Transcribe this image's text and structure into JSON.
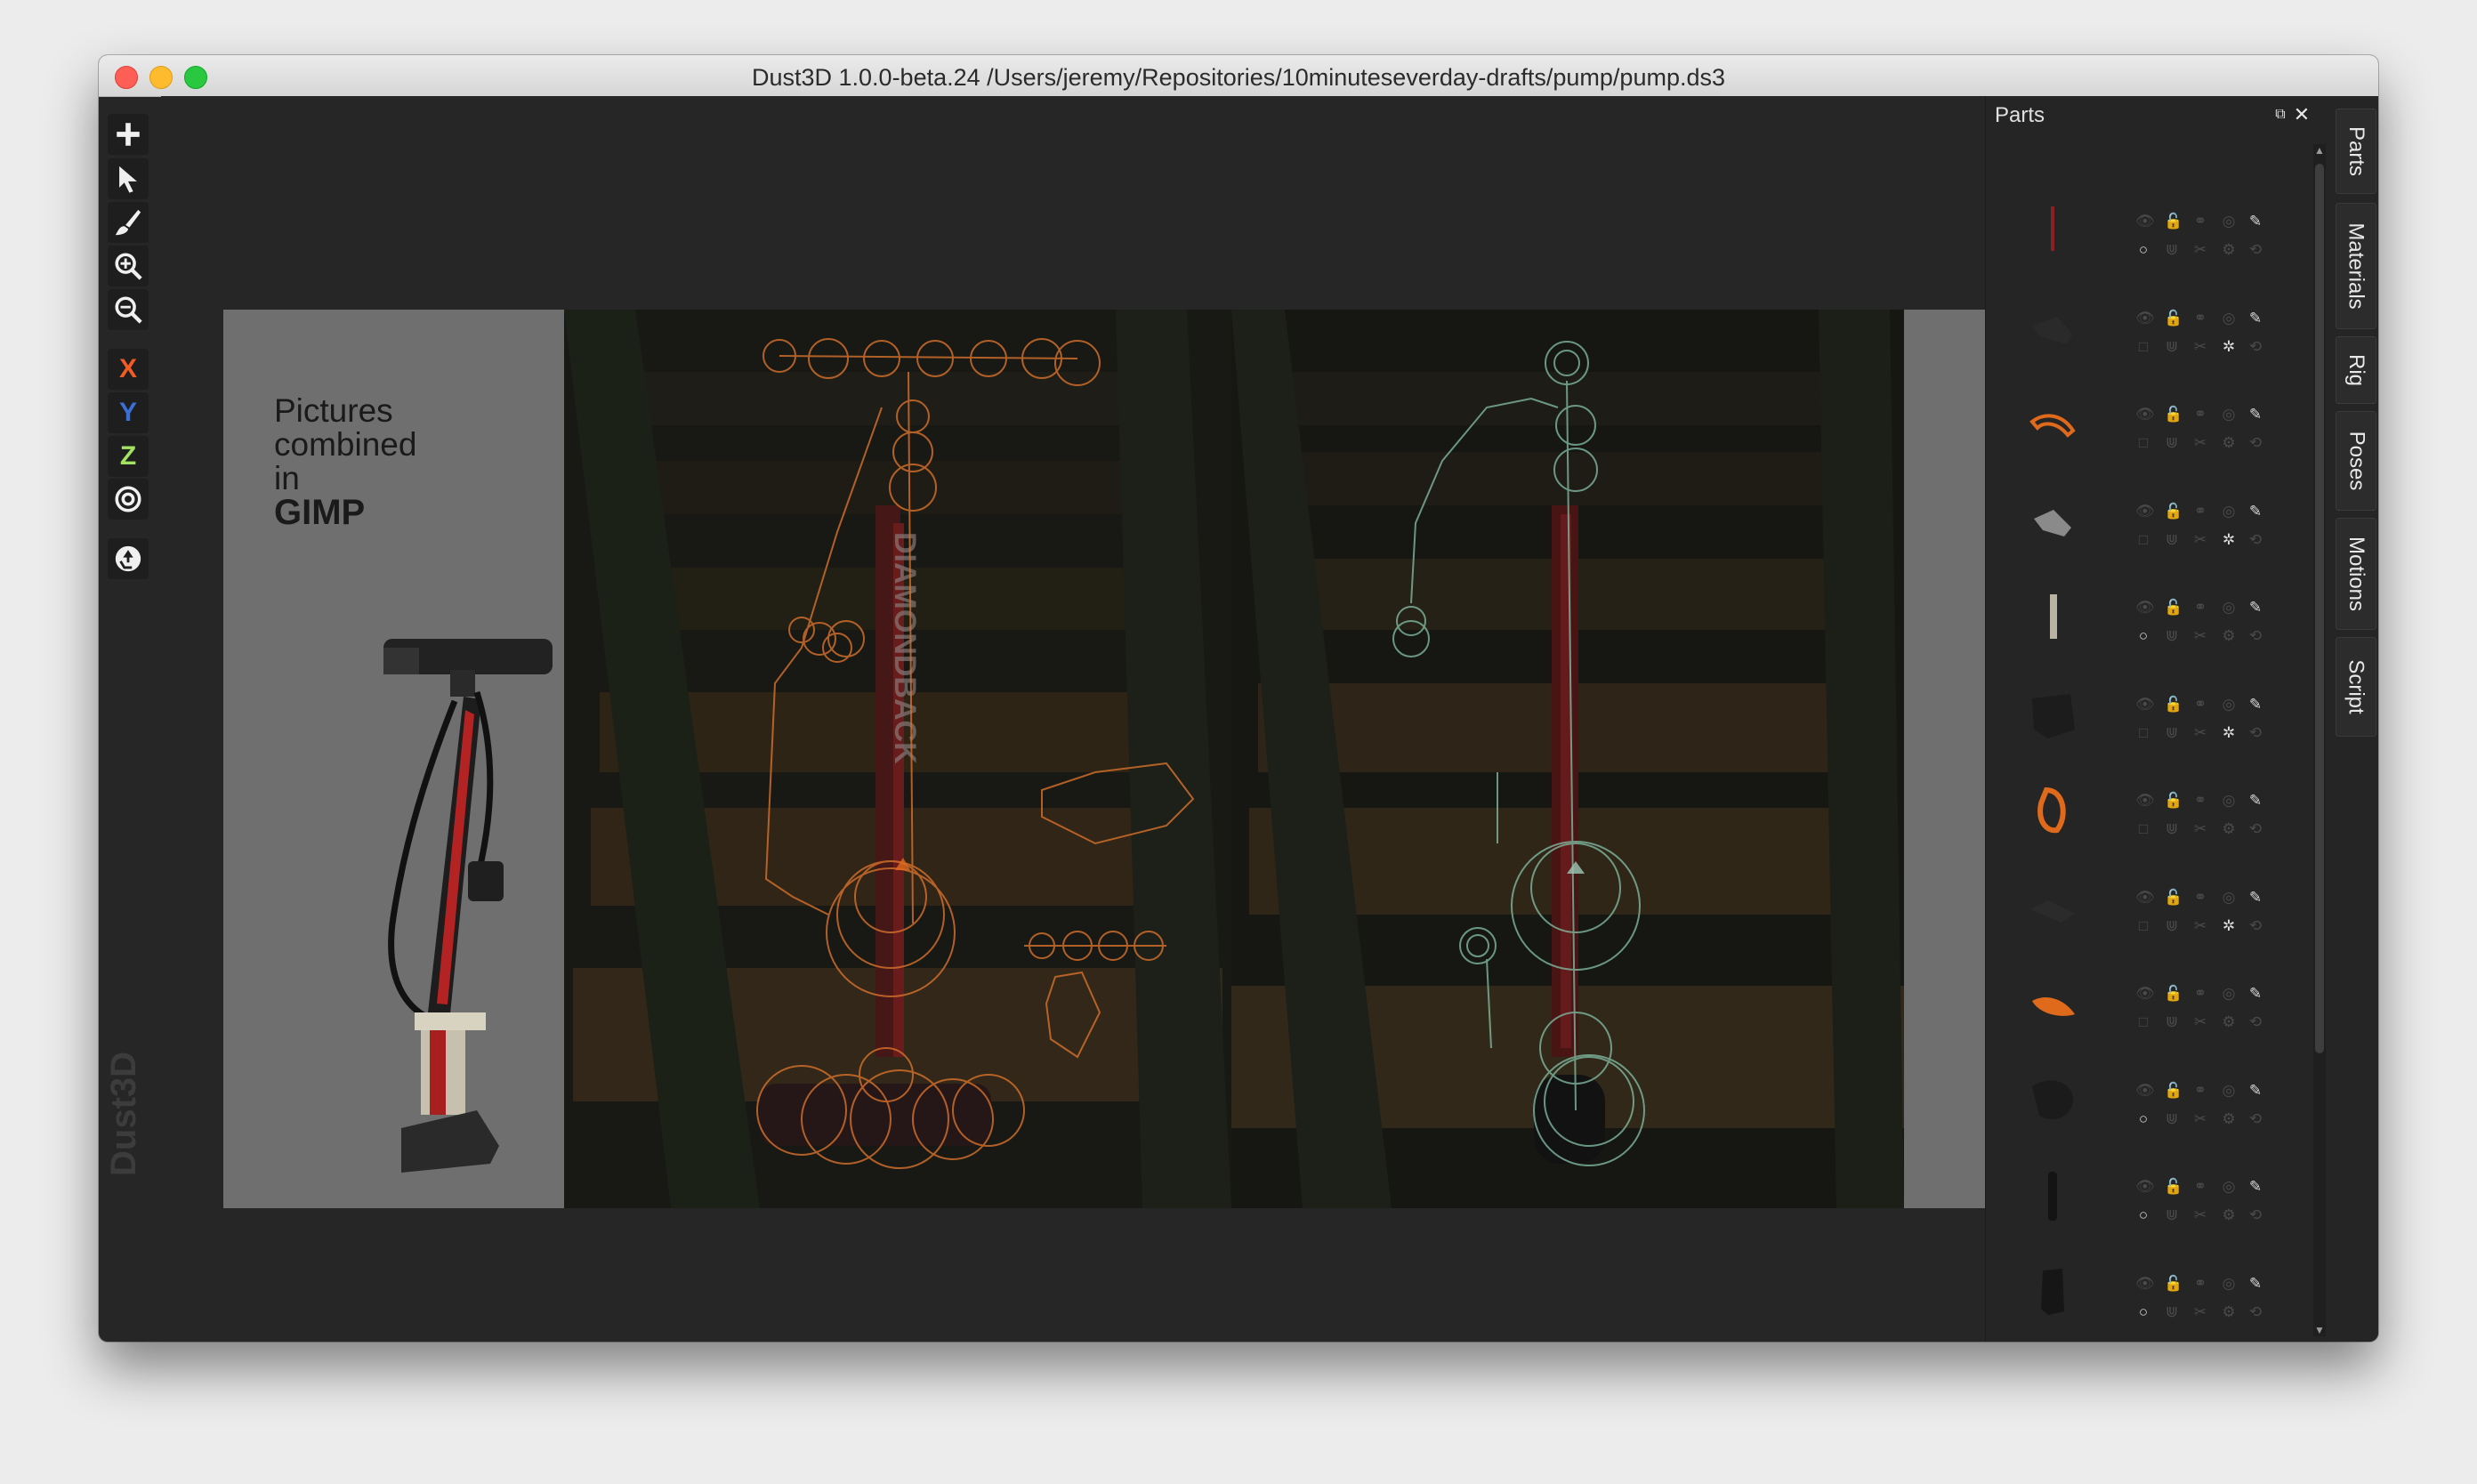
{
  "window": {
    "title": "Dust3D 1.0.0-beta.24 /Users/jeremy/Repositories/10minuteseverday-drafts/pump/pump.ds3"
  },
  "toolbar": {
    "tools": [
      {
        "name": "add-icon"
      },
      {
        "name": "select-arrow-icon"
      },
      {
        "name": "paint-brush-icon"
      },
      {
        "name": "zoom-in-icon"
      },
      {
        "name": "zoom-out-icon"
      }
    ],
    "axis_x": "X",
    "axis_y": "Y",
    "axis_z": "Z",
    "axis_colors": {
      "x": "#f25c22",
      "y": "#3a6fd8",
      "z": "#a3e263"
    },
    "radius_tool": "target-icon",
    "regenerate_tool": "recycle-icon"
  },
  "brand": "Dust3D",
  "reference": {
    "line1": "Pictures",
    "line2": "combined",
    "line3": "in",
    "line4": "GIMP",
    "pump_brand_text": "DIAMONDBACK"
  },
  "parts_panel": {
    "header": "Parts",
    "restore_icon": "restore-icon",
    "close_icon": "close-icon"
  },
  "side_tabs": [
    "Parts",
    "Materials",
    "Rig",
    "Poses",
    "Motions",
    "Script"
  ],
  "colors": {
    "accent_orange": "#e06a1c",
    "node_green": "#7fb8a0",
    "node_orange": "#d8722c"
  }
}
